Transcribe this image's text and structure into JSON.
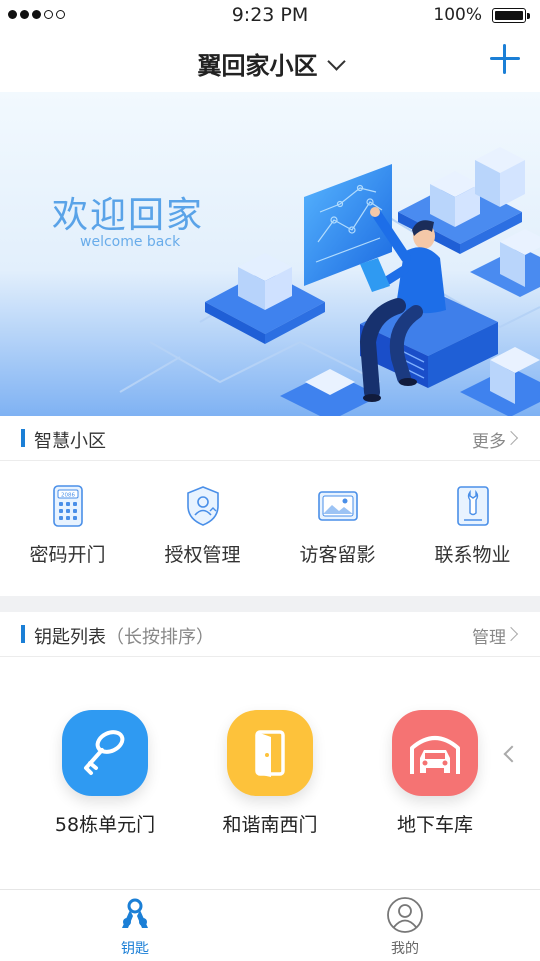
{
  "status": {
    "time": "9:23 PM",
    "battery": "100%"
  },
  "nav": {
    "title": "翼回家小区",
    "add_icon": "plus-icon",
    "accent": "#1b7fd6"
  },
  "banner": {
    "title": "欢迎回家",
    "subtitle": "welcome back"
  },
  "smart": {
    "title": "智慧小区",
    "more": "更多",
    "items": [
      {
        "label": "密码开门",
        "icon": "keypad-icon"
      },
      {
        "label": "授权管理",
        "icon": "shield-user-icon"
      },
      {
        "label": "访客留影",
        "icon": "photo-icon"
      },
      {
        "label": "联系物业",
        "icon": "wrench-icon"
      }
    ]
  },
  "keys": {
    "title": "钥匙列表",
    "hint": "（长按排序）",
    "manage": "管理",
    "items": [
      {
        "label": "58栋单元门",
        "icon": "key-icon",
        "color": "#2f9af2"
      },
      {
        "label": "和谐南西门",
        "icon": "door-icon",
        "color": "#fdc23b"
      },
      {
        "label": "地下车库",
        "icon": "car-garage-icon",
        "color": "#f57373"
      }
    ]
  },
  "tabs": [
    {
      "label": "钥匙",
      "icon": "keys-tab-icon",
      "active": true,
      "color": "#1b7fd6"
    },
    {
      "label": "我的",
      "icon": "user-tab-icon",
      "active": false,
      "color": "#666666"
    }
  ]
}
